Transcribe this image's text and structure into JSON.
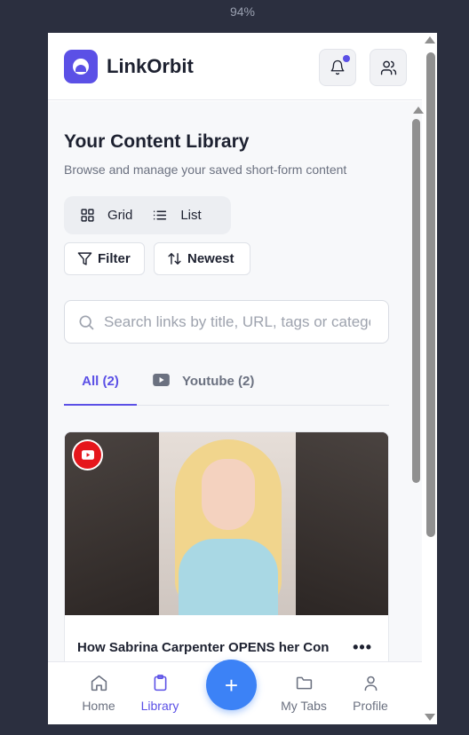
{
  "browser": {
    "zoom": "94%"
  },
  "header": {
    "brand": "LinkOrbit"
  },
  "library": {
    "title": "Your Content Library",
    "subtitle": "Browse and manage your saved short-form content",
    "view_toggle": {
      "grid_label": "Grid",
      "list_label": "List"
    },
    "filter_label": "Filter",
    "sort_label": "Newest",
    "search": {
      "placeholder": "Search links by title, URL, tags or category",
      "value": ""
    },
    "tabs": [
      {
        "label": "All (2)",
        "active": true
      },
      {
        "label": "Youtube (2)",
        "active": false
      }
    ],
    "cards": [
      {
        "platform": "youtube",
        "title": "How Sabrina Carpenter OPENS her Con",
        "more": "•••"
      }
    ]
  },
  "bottom_nav": {
    "items": [
      {
        "label": "Home",
        "icon": "home-icon",
        "active": false
      },
      {
        "label": "Library",
        "icon": "library-icon",
        "active": true
      },
      {
        "label": "My Tabs",
        "icon": "folder-icon",
        "active": false
      },
      {
        "label": "Profile",
        "icon": "user-icon",
        "active": false
      }
    ],
    "fab_label": "+"
  },
  "colors": {
    "accent": "#5b50e6",
    "fab": "#3c82f6",
    "youtube": "#e5161c"
  }
}
